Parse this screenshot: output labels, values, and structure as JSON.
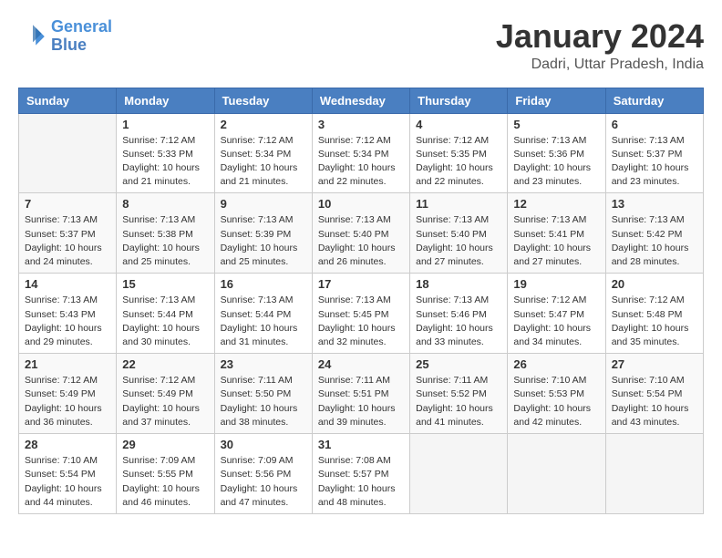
{
  "header": {
    "logo_line1": "General",
    "logo_line2": "Blue",
    "month": "January 2024",
    "location": "Dadri, Uttar Pradesh, India"
  },
  "weekdays": [
    "Sunday",
    "Monday",
    "Tuesday",
    "Wednesday",
    "Thursday",
    "Friday",
    "Saturday"
  ],
  "weeks": [
    [
      {
        "day": null,
        "sunrise": null,
        "sunset": null,
        "daylight": null
      },
      {
        "day": "1",
        "sunrise": "Sunrise: 7:12 AM",
        "sunset": "Sunset: 5:33 PM",
        "daylight": "Daylight: 10 hours and 21 minutes."
      },
      {
        "day": "2",
        "sunrise": "Sunrise: 7:12 AM",
        "sunset": "Sunset: 5:34 PM",
        "daylight": "Daylight: 10 hours and 21 minutes."
      },
      {
        "day": "3",
        "sunrise": "Sunrise: 7:12 AM",
        "sunset": "Sunset: 5:34 PM",
        "daylight": "Daylight: 10 hours and 22 minutes."
      },
      {
        "day": "4",
        "sunrise": "Sunrise: 7:12 AM",
        "sunset": "Sunset: 5:35 PM",
        "daylight": "Daylight: 10 hours and 22 minutes."
      },
      {
        "day": "5",
        "sunrise": "Sunrise: 7:13 AM",
        "sunset": "Sunset: 5:36 PM",
        "daylight": "Daylight: 10 hours and 23 minutes."
      },
      {
        "day": "6",
        "sunrise": "Sunrise: 7:13 AM",
        "sunset": "Sunset: 5:37 PM",
        "daylight": "Daylight: 10 hours and 23 minutes."
      }
    ],
    [
      {
        "day": "7",
        "sunrise": "Sunrise: 7:13 AM",
        "sunset": "Sunset: 5:37 PM",
        "daylight": "Daylight: 10 hours and 24 minutes."
      },
      {
        "day": "8",
        "sunrise": "Sunrise: 7:13 AM",
        "sunset": "Sunset: 5:38 PM",
        "daylight": "Daylight: 10 hours and 25 minutes."
      },
      {
        "day": "9",
        "sunrise": "Sunrise: 7:13 AM",
        "sunset": "Sunset: 5:39 PM",
        "daylight": "Daylight: 10 hours and 25 minutes."
      },
      {
        "day": "10",
        "sunrise": "Sunrise: 7:13 AM",
        "sunset": "Sunset: 5:40 PM",
        "daylight": "Daylight: 10 hours and 26 minutes."
      },
      {
        "day": "11",
        "sunrise": "Sunrise: 7:13 AM",
        "sunset": "Sunset: 5:40 PM",
        "daylight": "Daylight: 10 hours and 27 minutes."
      },
      {
        "day": "12",
        "sunrise": "Sunrise: 7:13 AM",
        "sunset": "Sunset: 5:41 PM",
        "daylight": "Daylight: 10 hours and 27 minutes."
      },
      {
        "day": "13",
        "sunrise": "Sunrise: 7:13 AM",
        "sunset": "Sunset: 5:42 PM",
        "daylight": "Daylight: 10 hours and 28 minutes."
      }
    ],
    [
      {
        "day": "14",
        "sunrise": "Sunrise: 7:13 AM",
        "sunset": "Sunset: 5:43 PM",
        "daylight": "Daylight: 10 hours and 29 minutes."
      },
      {
        "day": "15",
        "sunrise": "Sunrise: 7:13 AM",
        "sunset": "Sunset: 5:44 PM",
        "daylight": "Daylight: 10 hours and 30 minutes."
      },
      {
        "day": "16",
        "sunrise": "Sunrise: 7:13 AM",
        "sunset": "Sunset: 5:44 PM",
        "daylight": "Daylight: 10 hours and 31 minutes."
      },
      {
        "day": "17",
        "sunrise": "Sunrise: 7:13 AM",
        "sunset": "Sunset: 5:45 PM",
        "daylight": "Daylight: 10 hours and 32 minutes."
      },
      {
        "day": "18",
        "sunrise": "Sunrise: 7:13 AM",
        "sunset": "Sunset: 5:46 PM",
        "daylight": "Daylight: 10 hours and 33 minutes."
      },
      {
        "day": "19",
        "sunrise": "Sunrise: 7:12 AM",
        "sunset": "Sunset: 5:47 PM",
        "daylight": "Daylight: 10 hours and 34 minutes."
      },
      {
        "day": "20",
        "sunrise": "Sunrise: 7:12 AM",
        "sunset": "Sunset: 5:48 PM",
        "daylight": "Daylight: 10 hours and 35 minutes."
      }
    ],
    [
      {
        "day": "21",
        "sunrise": "Sunrise: 7:12 AM",
        "sunset": "Sunset: 5:49 PM",
        "daylight": "Daylight: 10 hours and 36 minutes."
      },
      {
        "day": "22",
        "sunrise": "Sunrise: 7:12 AM",
        "sunset": "Sunset: 5:49 PM",
        "daylight": "Daylight: 10 hours and 37 minutes."
      },
      {
        "day": "23",
        "sunrise": "Sunrise: 7:11 AM",
        "sunset": "Sunset: 5:50 PM",
        "daylight": "Daylight: 10 hours and 38 minutes."
      },
      {
        "day": "24",
        "sunrise": "Sunrise: 7:11 AM",
        "sunset": "Sunset: 5:51 PM",
        "daylight": "Daylight: 10 hours and 39 minutes."
      },
      {
        "day": "25",
        "sunrise": "Sunrise: 7:11 AM",
        "sunset": "Sunset: 5:52 PM",
        "daylight": "Daylight: 10 hours and 41 minutes."
      },
      {
        "day": "26",
        "sunrise": "Sunrise: 7:10 AM",
        "sunset": "Sunset: 5:53 PM",
        "daylight": "Daylight: 10 hours and 42 minutes."
      },
      {
        "day": "27",
        "sunrise": "Sunrise: 7:10 AM",
        "sunset": "Sunset: 5:54 PM",
        "daylight": "Daylight: 10 hours and 43 minutes."
      }
    ],
    [
      {
        "day": "28",
        "sunrise": "Sunrise: 7:10 AM",
        "sunset": "Sunset: 5:54 PM",
        "daylight": "Daylight: 10 hours and 44 minutes."
      },
      {
        "day": "29",
        "sunrise": "Sunrise: 7:09 AM",
        "sunset": "Sunset: 5:55 PM",
        "daylight": "Daylight: 10 hours and 46 minutes."
      },
      {
        "day": "30",
        "sunrise": "Sunrise: 7:09 AM",
        "sunset": "Sunset: 5:56 PM",
        "daylight": "Daylight: 10 hours and 47 minutes."
      },
      {
        "day": "31",
        "sunrise": "Sunrise: 7:08 AM",
        "sunset": "Sunset: 5:57 PM",
        "daylight": "Daylight: 10 hours and 48 minutes."
      },
      {
        "day": null,
        "sunrise": null,
        "sunset": null,
        "daylight": null
      },
      {
        "day": null,
        "sunrise": null,
        "sunset": null,
        "daylight": null
      },
      {
        "day": null,
        "sunrise": null,
        "sunset": null,
        "daylight": null
      }
    ]
  ]
}
